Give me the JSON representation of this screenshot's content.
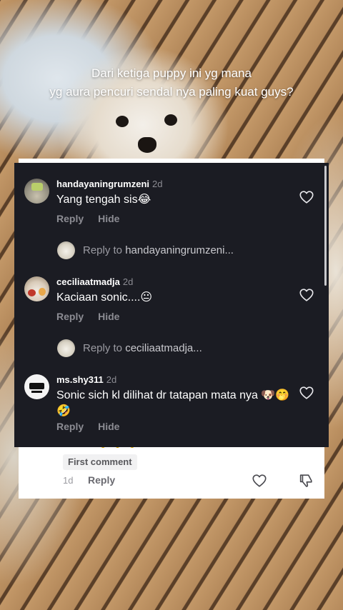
{
  "caption": {
    "line1": "Dari ketiga puppy ini yg mana",
    "line2": "yg aura pencuri sendal nya paling kuat guys?"
  },
  "comments": [
    {
      "username": "handayaningrumzeni",
      "time": "2d",
      "text": "Yang tengah sis",
      "emoji": "😂",
      "reply": "Reply",
      "hide": "Hide",
      "like_icon": "heart-outline-icon"
    },
    {
      "username": "ceciliaatmadja",
      "time": "2d",
      "text": "Kaciaan sonic....",
      "emoji": "😐",
      "reply": "Reply",
      "hide": "Hide",
      "like_icon": "heart-outline-icon"
    },
    {
      "username": "ms.shy311",
      "time": "2d",
      "text": "Sonic sich kl dilihat dr tatapan mata nya",
      "emoji": "🐶🤭🤣",
      "reply": "Reply",
      "hide": "Hide",
      "like_icon": "heart-outline-icon"
    }
  ],
  "reply_to": [
    {
      "prefix": "Reply to",
      "target": "handayaningrumzeni..."
    },
    {
      "prefix": "Reply to",
      "target": "ceciliaatmadja..."
    }
  ],
  "background_comment": {
    "badge": "First comment",
    "time": "1d",
    "reply": "Reply",
    "like_icon": "heart-outline-icon",
    "dislike_icon": "thumbs-down-outline-icon"
  },
  "colors": {
    "panel": "#1b1c23",
    "muted": "#8c8c93",
    "text": "#ffffff"
  }
}
